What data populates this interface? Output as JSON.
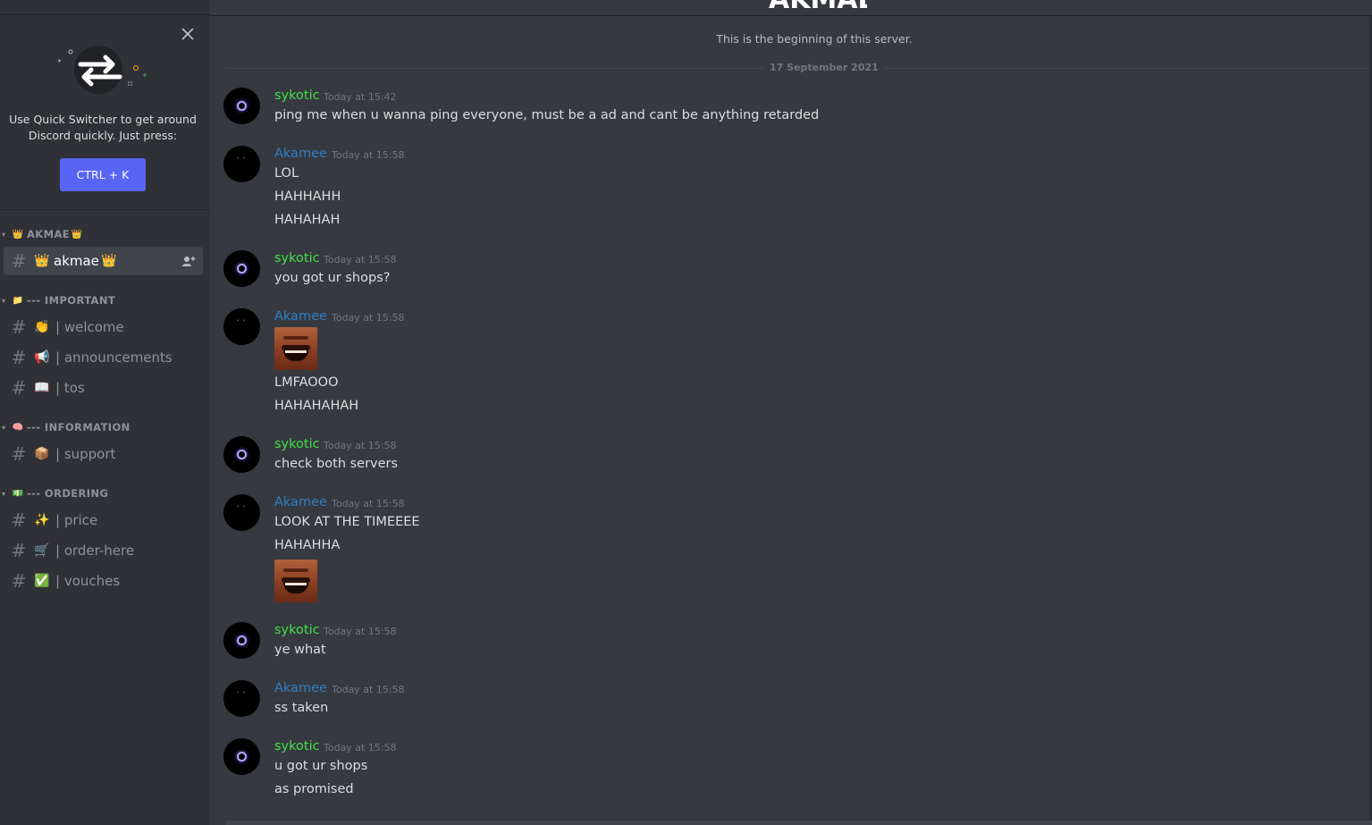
{
  "colors": {
    "accent": "#5865f2",
    "green_user": "#43e04a",
    "blue_user": "#2e7fc6",
    "bg": "#36393f",
    "sidebar": "#2f3136"
  },
  "quick_switcher": {
    "text_line1": "Use Quick Switcher to get around",
    "text_line2": "Discord quickly. Just press:",
    "button_label": "CTRL + K",
    "close_icon": "close-icon",
    "art_icon": "arrows-swap-icon"
  },
  "categories": [
    {
      "emoji": "👑",
      "label": "AKMAE",
      "suffix": "👑"
    },
    {
      "emoji": "📁",
      "label": "--- IMPORTANT"
    },
    {
      "emoji": "🧠",
      "label": "--- INFORMATION"
    },
    {
      "emoji": "💵",
      "label": "--- ORDERING"
    }
  ],
  "channels": [
    {
      "emoji": "👑",
      "label": "akmae",
      "suffix": "👑",
      "active": true
    },
    {
      "emoji": "👏",
      "label": "| welcome"
    },
    {
      "emoji": "📢",
      "label": "| announcements"
    },
    {
      "emoji": "📖",
      "label": "| tos"
    },
    {
      "emoji": "📦",
      "label": "| support"
    },
    {
      "emoji": "✨",
      "label": "| price"
    },
    {
      "emoji": "🛒",
      "label": "| order-here"
    },
    {
      "emoji": "✅",
      "label": "| vouches"
    }
  ],
  "main": {
    "server_title": "AKMAE",
    "beginning": "This is the beginning of this server.",
    "date_divider": "17 September 2021"
  },
  "messages": [
    {
      "author": "sykotic",
      "time": "Today at 15:42",
      "lines": [
        "ping me when u wanna ping everyone, must be a ad and cant be anything retarded"
      ]
    },
    {
      "author": "Akamee",
      "time": "Today at 15:58",
      "lines": [
        "LOL",
        "HAHHAHH",
        "HAHAHAH"
      ]
    },
    {
      "author": "sykotic",
      "time": "Today at 15:58",
      "lines": [
        "you got ur shops?"
      ]
    },
    {
      "author": "Akamee",
      "time": "Today at 15:58",
      "lines": [
        "LMFAOOO",
        "HAHAHAHAH"
      ],
      "emote_name": "laughing-emote"
    },
    {
      "author": "sykotic",
      "time": "Today at 15:58",
      "lines": [
        "check both servers"
      ]
    },
    {
      "author": "Akamee",
      "time": "Today at 15:58",
      "lines": [
        "LOOK AT THE TIMEEEE",
        "HAHAHHA"
      ],
      "emote_name": "laughing-emote"
    },
    {
      "author": "sykotic",
      "time": "Today at 15:58",
      "lines": [
        "ye what"
      ]
    },
    {
      "author": "Akamee",
      "time": "Today at 15:58",
      "lines": [
        "ss taken"
      ]
    },
    {
      "author": "sykotic",
      "time": "Today at 15:58",
      "lines": [
        "u got ur shops",
        "as promised"
      ]
    }
  ]
}
